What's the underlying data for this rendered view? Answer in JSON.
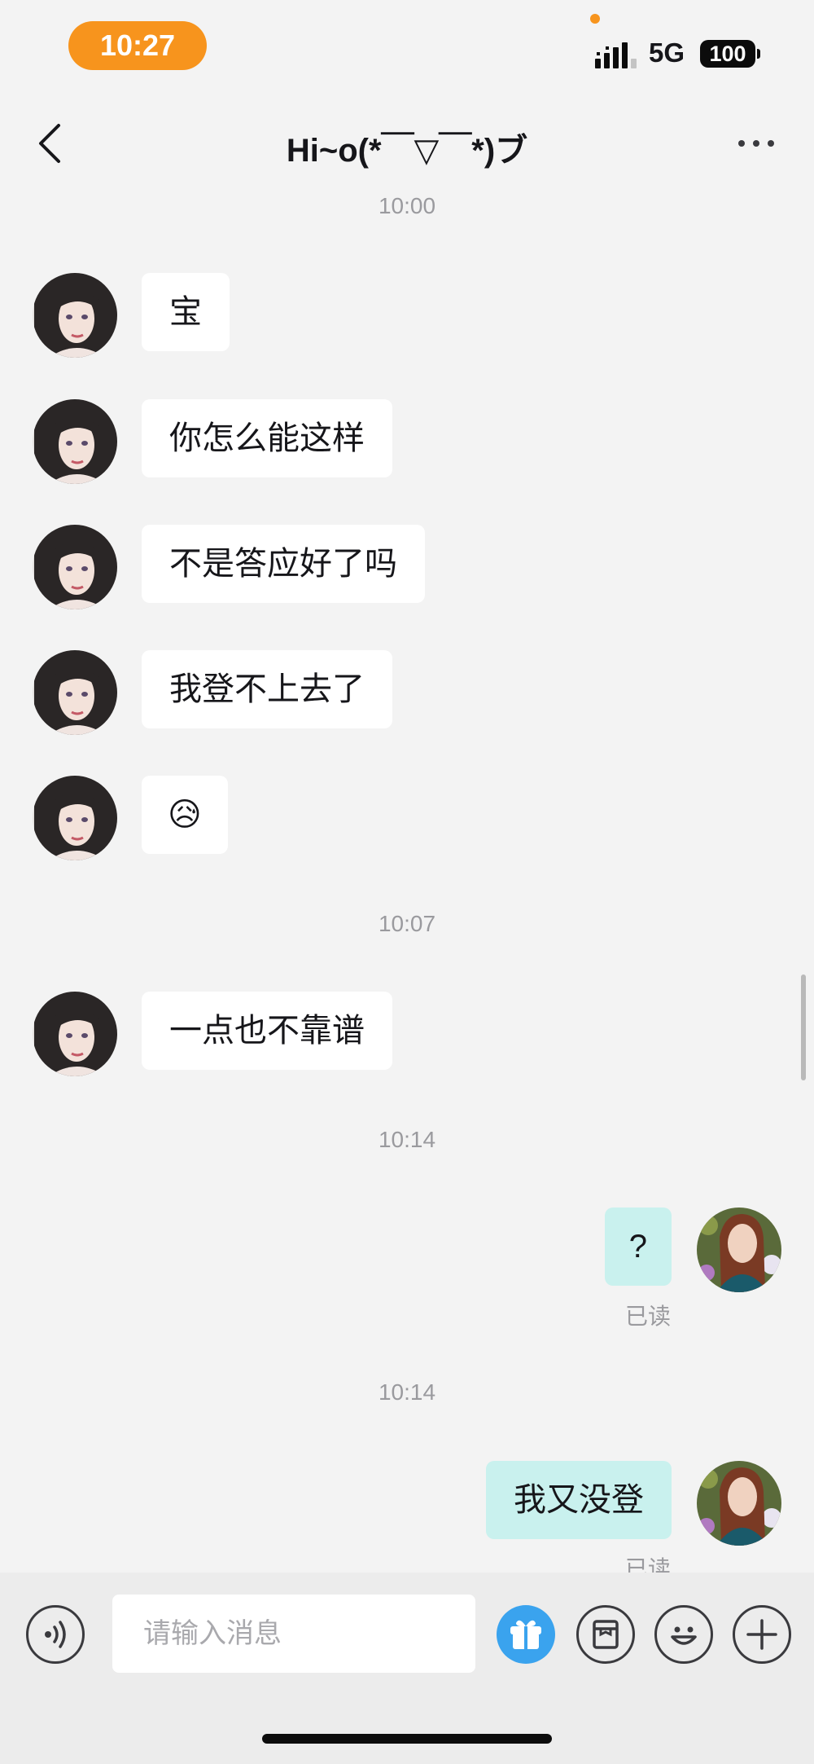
{
  "status_bar": {
    "time": "10:27",
    "network": "5G",
    "battery": "100"
  },
  "header": {
    "title": "Hi~o(*￣▽￣*)ブ"
  },
  "messages": {
    "ts1": "10:00",
    "m1": "宝",
    "m2": "你怎么能这样",
    "m3": "不是答应好了吗",
    "m4": "我登不上去了",
    "m5": "😥",
    "ts2": "10:07",
    "m6": "一点也不靠谱",
    "ts3": "10:14",
    "out1": "?",
    "read1": "已读",
    "ts4": "10:14",
    "out2": "我又没登",
    "read2": "已读"
  },
  "input": {
    "placeholder": "请输入消息"
  },
  "icons": {
    "back": "back-chevron-icon",
    "more": "more-icon",
    "voice": "voice-icon",
    "gift": "gift-icon",
    "sticker": "sticker-icon",
    "emoji": "emoji-icon",
    "plus": "plus-icon"
  },
  "colors": {
    "accent": "#f7941d",
    "outgoing_bubble": "#c9f1ee",
    "incoming_bubble": "#ffffff",
    "gift": "#3aa3ee",
    "background": "#f3f3f3"
  }
}
